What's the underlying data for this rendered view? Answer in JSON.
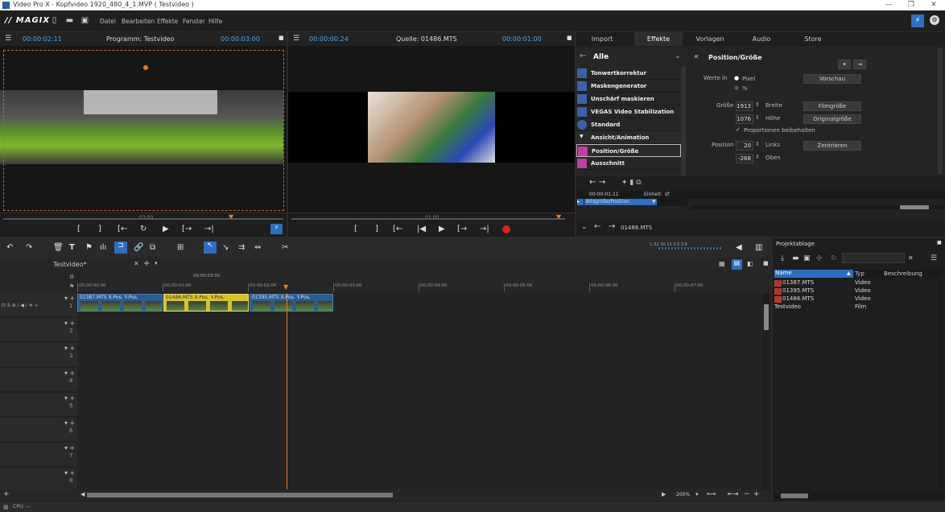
{
  "window": {
    "title": "Video Pro X - Kopfvideo 1920_480_4_1.MVP ( Testvideo )",
    "minimize": "—",
    "maximize": "❐",
    "close": "✕"
  },
  "menubar": {
    "logo": "// MAGIX",
    "items": [
      "Datei",
      "Bearbeiten",
      "Effekte",
      "Fenster",
      "Hilfe"
    ]
  },
  "program_monitor": {
    "timecode_left": "00:00:02:11",
    "title": "Programm: Testvideo",
    "timecode_right": "00:00:03:00",
    "ruler_label": "03:00"
  },
  "source_monitor": {
    "timecode_left": "00:00:00:24",
    "title": "Quelle: 01486.MTS",
    "timecode_right": "00:00:01:00",
    "ruler_label": "01:00"
  },
  "right_panel": {
    "tabs": [
      "Import",
      "Effekte",
      "Vorlagen",
      "Audio",
      "Store"
    ],
    "active_tab": "Effekte",
    "category": "Alle",
    "effects": [
      "Tonwertkorrektur",
      "Maskengenerator",
      "Unschärf maskieren",
      "VEGAS Video Stabilization",
      "Standard",
      "Ansicht/Animation",
      "Position/Größe",
      "Ausschnitt"
    ],
    "selected_effect": "Position/Größe",
    "props": {
      "title": "Position/Größe",
      "werte_in_label": "Werte in",
      "unit_pixel": "Pixel",
      "unit_percent": "%",
      "vorschau_btn": "Vorschau",
      "groesse_label": "Größe",
      "breite_value": "1913",
      "breite_label": "Breite",
      "hoehe_value": "1076",
      "hoehe_label": "Höhe",
      "filmgroesse_btn": "Filmgröße",
      "originalgroesse_btn": "Originalgröße",
      "proportionen_label": "Proportionen beibehalten",
      "position_label": "Position",
      "links_value": "20",
      "links_label": "Links",
      "oben_value": "-268",
      "oben_label": "Oben",
      "zentrieren_btn": "Zentrieren"
    },
    "keyframe": {
      "timecode": "00:00:01:11",
      "einheit_label": "Einheit:",
      "einheit_value": "sf",
      "track_label": "Bildgröße/Position"
    },
    "nav_item": "01486.MTS"
  },
  "timeline": {
    "tab_name": "Testvideo*",
    "top_timecode": "00:00:03:00",
    "ruler_ticks": [
      "00:00:00:00",
      "00:00:01:00",
      "00:00:02:00",
      "00:00:03:00",
      "00:00:04:00",
      "00:00:05:00",
      "00:00:06:00",
      "00:00:07:00"
    ],
    "tracks": [
      "1",
      "2",
      "3",
      "4",
      "5",
      "6",
      "7",
      "8"
    ],
    "clips": [
      {
        "label": "01387.MTS  X-Pos.  Y-Pos.",
        "color": "#2b5d8a"
      },
      {
        "label": "01486.MTS  X-Pos.  Y-Pos.",
        "color": "#d8c22a"
      },
      {
        "label": "01395.MTS  X-Pos.  Y-Pos.",
        "color": "#2b5d8a"
      }
    ],
    "zoom": "200%",
    "meter_scale": "L  52  30  12    3  0  3  6"
  },
  "project": {
    "title": "Projektablage",
    "columns": [
      "Name",
      "Typ",
      "Beschreibung"
    ],
    "rows": [
      {
        "name": "01387.MTS",
        "type": "Video"
      },
      {
        "name": "01395.MTS",
        "type": "Video"
      },
      {
        "name": "01486.MTS",
        "type": "Video"
      },
      {
        "name": "Testvideo",
        "type": "Film"
      }
    ]
  },
  "statusbar": {
    "cpu": "CPU: —"
  }
}
